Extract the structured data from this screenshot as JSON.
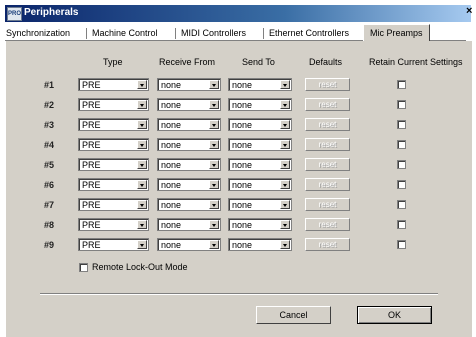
{
  "window": {
    "title": "Peripherals",
    "app_icon_text": "PRO"
  },
  "tabs": [
    {
      "label": "Synchronization"
    },
    {
      "label": "Machine Control"
    },
    {
      "label": "MIDI Controllers"
    },
    {
      "label": "Ethernet Controllers"
    },
    {
      "label": "Mic Preamps"
    }
  ],
  "active_tab": "Mic Preamps",
  "columns": {
    "type": "Type",
    "receive_from": "Receive From",
    "send_to": "Send To",
    "defaults": "Defaults",
    "retain": "Retain Current Settings"
  },
  "rows": [
    {
      "label": "#1",
      "type": "PRE",
      "receive_from": "none",
      "send_to": "none",
      "reset": "reset",
      "retain": false
    },
    {
      "label": "#2",
      "type": "PRE",
      "receive_from": "none",
      "send_to": "none",
      "reset": "reset",
      "retain": false
    },
    {
      "label": "#3",
      "type": "PRE",
      "receive_from": "none",
      "send_to": "none",
      "reset": "reset",
      "retain": false
    },
    {
      "label": "#4",
      "type": "PRE",
      "receive_from": "none",
      "send_to": "none",
      "reset": "reset",
      "retain": false
    },
    {
      "label": "#5",
      "type": "PRE",
      "receive_from": "none",
      "send_to": "none",
      "reset": "reset",
      "retain": false
    },
    {
      "label": "#6",
      "type": "PRE",
      "receive_from": "none",
      "send_to": "none",
      "reset": "reset",
      "retain": false
    },
    {
      "label": "#7",
      "type": "PRE",
      "receive_from": "none",
      "send_to": "none",
      "reset": "reset",
      "retain": false
    },
    {
      "label": "#8",
      "type": "PRE",
      "receive_from": "none",
      "send_to": "none",
      "reset": "reset",
      "retain": false
    },
    {
      "label": "#9",
      "type": "PRE",
      "receive_from": "none",
      "send_to": "none",
      "reset": "reset",
      "retain": false
    }
  ],
  "remote_lockout": {
    "label": "Remote Lock-Out Mode",
    "checked": false
  },
  "buttons": {
    "cancel": "Cancel",
    "ok": "OK"
  },
  "icons": {
    "close": "close-icon",
    "dropdown": "chevron-down-icon",
    "app": "pro-tools-app-icon"
  }
}
